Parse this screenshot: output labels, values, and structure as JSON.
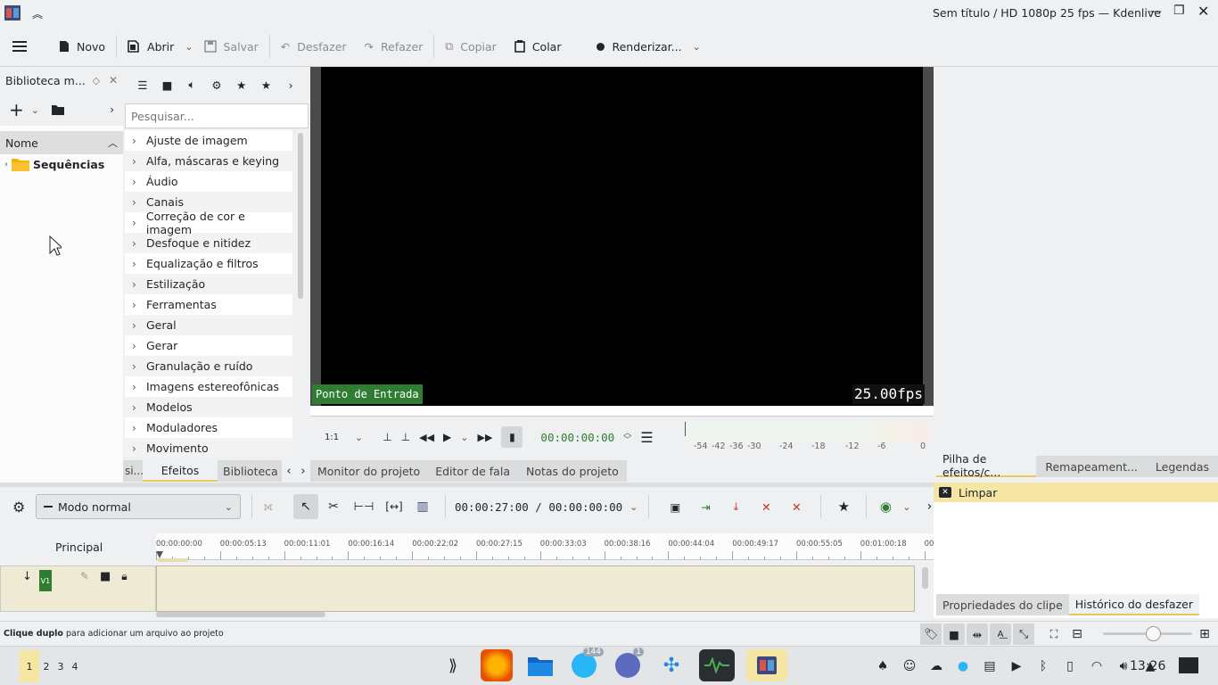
{
  "window": {
    "title": "Sem título / HD 1080p 25 fps — Kdenlive"
  },
  "toolbar": {
    "new": "Novo",
    "open": "Abrir",
    "save": "Salvar",
    "undo": "Desfazer",
    "redo": "Refazer",
    "copy": "Copiar",
    "paste": "Colar",
    "render": "Renderizar..."
  },
  "library": {
    "title": "Biblioteca m...",
    "column": "Nome",
    "item": "Sequências"
  },
  "effects": {
    "search_placeholder": "Pesquisar...",
    "items": [
      "Ajuste de imagem",
      "Alfa, máscaras e keying",
      "Áudio",
      "Canais",
      "Correção de cor e imagem",
      "Desfoque e nitidez",
      "Equalização e filtros",
      "Estilização",
      "Ferramentas",
      "Geral",
      "Gerar",
      "Granulação e ruído",
      "Imagens estereofônicas",
      "Modelos",
      "Moduladores",
      "Movimento"
    ],
    "tabs": [
      "si...",
      "Efeitos",
      "Biblioteca"
    ]
  },
  "monitor": {
    "in_point": "Ponto de Entrada",
    "fps": "25.00fps",
    "zoom": "1:1",
    "timecode": "00:00:00:00",
    "meter_labels": [
      "-54",
      "-42",
      "-36",
      "-30",
      "-24",
      "-18",
      "-12",
      "-6",
      "0"
    ],
    "tabs": [
      "Monitor do projeto",
      "Editor de fala",
      "Notas do projeto"
    ]
  },
  "right_panel": {
    "tabs": [
      "Pilha de efeitos/c...",
      "Remapeament...",
      "Legendas"
    ],
    "clear": "Limpar",
    "bottom_tabs": [
      "Propriedades do clipe",
      "Histórico do desfazer"
    ]
  },
  "timeline": {
    "mode": "Modo normal",
    "timecode": "00:00:27:00 / 00:00:00:00",
    "track_header": "Principal",
    "track_v1": "V1",
    "ruler": [
      "00:00:00:00",
      "00:00:05:13",
      "00:00:11:01",
      "00:00:16:14",
      "00:00:22:02",
      "00:00:27:15",
      "00:00:33:03",
      "00:00:38:16",
      "00:00:44:04",
      "00:00:49:17",
      "00:00:55:05",
      "00:01:00:18",
      "00"
    ]
  },
  "status": {
    "bold": "Clique duplo",
    "text": " para adicionar um arquivo ao projeto"
  },
  "taskbar": {
    "desktops": [
      "1",
      "2",
      "3",
      "4"
    ],
    "telegram_badge": "144",
    "discord_badge": "1",
    "clock": "13:26"
  },
  "colors": {
    "accent_green": "#2e7d32",
    "selection": "#f5e6a3",
    "timeline_bg": "#eeead4"
  }
}
